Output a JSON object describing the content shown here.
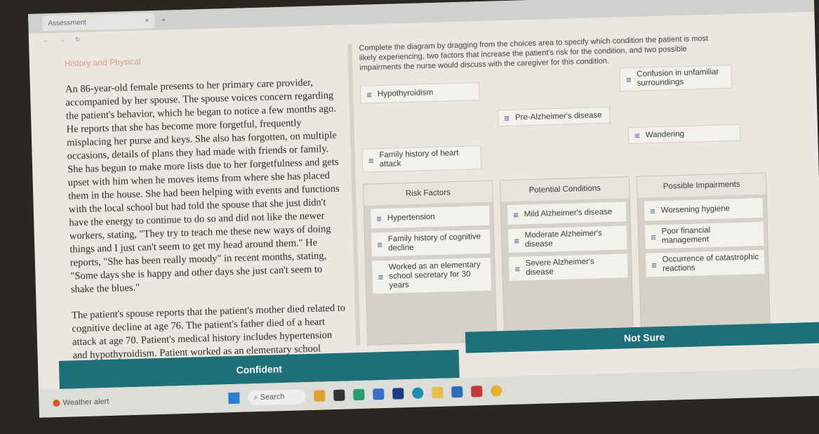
{
  "browser": {
    "tab_title": "Assessment"
  },
  "left": {
    "heading": "History and Physical",
    "paragraphs": [
      "An 86-year-old female presents to her primary care provider, accompanied by her spouse. The spouse voices concern regarding the patient's behavior, which he began to notice a few months ago. He reports that she has become more forgetful, frequently misplacing her purse and keys. She also has forgotten, on multiple occasions, details of plans they had made with friends or family. She has begun to make more lists due to her forgetfulness and gets upset with him when he moves items from where she has placed them in the house. She had been helping with events and functions with the local school but had told the spouse that she just didn't have the energy to continue to do so and did not like the newer workers, stating, \"They try to teach me these new ways of doing things and I just can't seem to get my head around them.\" He reports, \"She has been really moody\" in recent months, stating, \"Some days she is happy and other days she just can't seem to shake the blues.\"",
      "The patient's spouse reports that the patient's mother died related to cognitive decline at age 76. The patient's father died of a heart attack at age 70. Patient's medical history includes hypertension and hypothyroidism. Patient worked as an elementary school"
    ]
  },
  "instructions": "Complete the diagram by dragging from the choices area to specify which condition the patient is most likely experiencing, two factors that increase the patient's risk for the condition, and two possible impairments the nurse would discuss with the caregiver for this condition.",
  "choices": [
    "Hypothyroidism",
    "Confusion in unfamiliar surroundings",
    "Pre-Alzheimer's disease",
    "Wandering",
    "Family history of heart attack"
  ],
  "columns": [
    {
      "title": "Risk Factors",
      "items": [
        "Hypertension",
        "Family history of cognitive decline",
        "Worked as an elementary school secretary for 30 years"
      ]
    },
    {
      "title": "Potential Conditions",
      "items": [
        "Mild Alzheimer's disease",
        "Moderate Alzheimer's disease",
        "Severe Alzheimer's disease"
      ]
    },
    {
      "title": "Possible Impairments",
      "items": [
        "Worsening hygiene",
        "Poor financial management",
        "Occurrence of catastrophic reactions"
      ]
    }
  ],
  "buttons": {
    "confident": "Confident",
    "not_sure": "Not Sure"
  },
  "taskbar": {
    "search": "Search",
    "weather": "Weather alert"
  },
  "colors": {
    "button": "#1e6f7a",
    "heading": "#d79b8b",
    "grip": "#3a4d80"
  }
}
